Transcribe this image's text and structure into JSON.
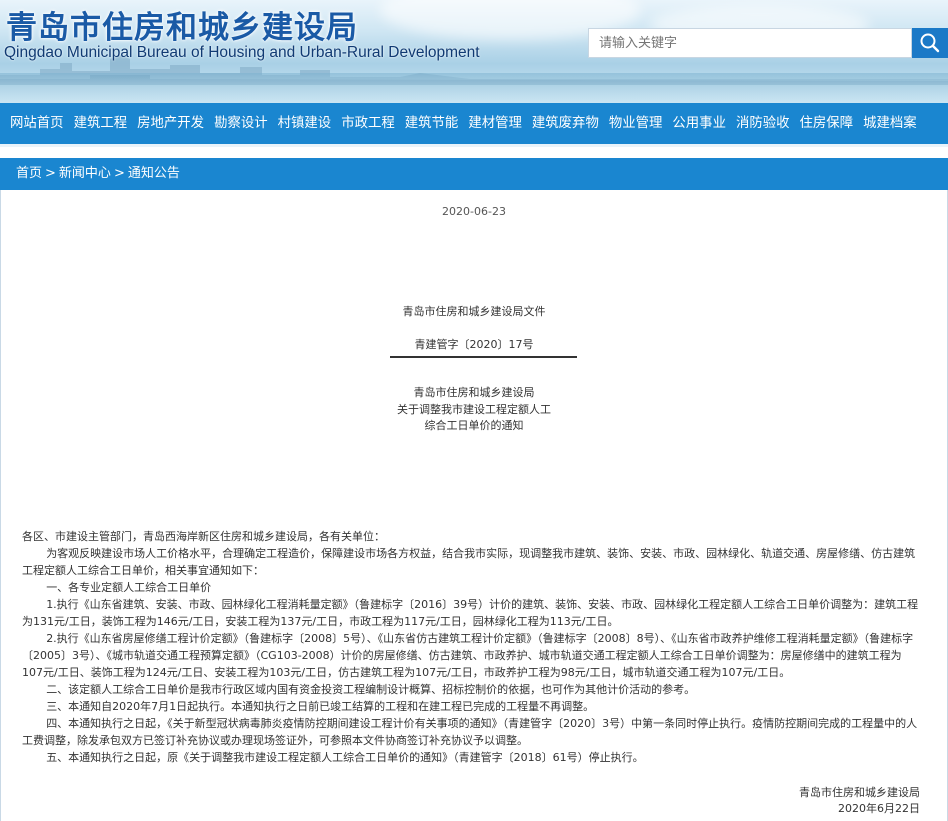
{
  "header": {
    "title_cn": "青岛市住房和城乡建设局",
    "title_en": "Qingdao Municipal Bureau of Housing and Urban-Rural Development",
    "search_placeholder": "请输入关键字"
  },
  "nav": {
    "items": [
      "网站首页",
      "建筑工程",
      "房地产开发",
      "勘察设计",
      "村镇建设",
      "市政工程",
      "建筑节能",
      "建材管理",
      "建筑废弃物",
      "物业管理",
      "公用事业",
      "消防验收",
      "住房保障",
      "城建档案"
    ]
  },
  "breadcrumb": {
    "items": [
      "首页",
      "新闻中心",
      "通知公告"
    ],
    "sep": ">"
  },
  "article": {
    "date": "2020-06-23",
    "doc_header": "青岛市住房和城乡建设局文件",
    "doc_number": "青建管字〔2020〕17号",
    "title_lines": [
      "青岛市住房和城乡建设局",
      "关于调整我市建设工程定额人工",
      "综合工日单价的通知"
    ],
    "salutation": "各区、市建设主管部门，青岛西海岸新区住房和城乡建设局，各有关单位：",
    "paragraphs": [
      "为客观反映建设市场人工价格水平，合理确定工程造价，保障建设市场各方权益，结合我市实际，现调整我市建筑、装饰、安装、市政、园林绿化、轨道交通、房屋修缮、仿古建筑工程定额人工综合工日单价，相关事宜通知如下：",
      "一、各专业定额人工综合工日单价",
      "1.执行《山东省建筑、安装、市政、园林绿化工程消耗量定额》（鲁建标字〔2016〕39号）计价的建筑、装饰、安装、市政、园林绿化工程定额人工综合工日单价调整为：建筑工程为131元/工日，装饰工程为146元/工日，安装工程为137元/工日，市政工程为117元/工日，园林绿化工程为113元/工日。",
      "2.执行《山东省房屋修缮工程计价定额》（鲁建标字〔2008〕5号）、《山东省仿古建筑工程计价定额》（鲁建标字〔2008〕8号）、《山东省市政养护维修工程消耗量定额》（鲁建标字〔2005〕3号）、《城市轨道交通工程预算定额》（CG103-2008）计价的房屋修缮、仿古建筑、市政养护、城市轨道交通工程定额人工综合工日单价调整为：房屋修缮中的建筑工程为107元/工日、装饰工程为124元/工日、安装工程为103元/工日，仿古建筑工程为107元/工日，市政养护工程为98元/工日，城市轨道交通工程为107元/工日。",
      "二、该定额人工综合工日单价是我市行政区域内国有资金投资工程编制设计概算、招标控制价的依据，也可作为其他计价活动的参考。",
      "三、本通知自2020年7月1日起执行。本通知执行之日前已竣工结算的工程和在建工程已完成的工程量不再调整。",
      "四、本通知执行之日起，《关于新型冠状病毒肺炎疫情防控期间建设工程计价有关事项的通知》（青建管字〔2020〕3号）中第一条同时停止执行。疫情防控期间完成的工程量中的人工费调整，除发承包双方已签订补充协议或办理现场签证外，可参照本文件协商签订补充协议予以调整。",
      "五、本通知执行之日起，原《关于调整我市建设工程定额人工综合工日单价的通知》（青建管字〔2018〕61号）停止执行。"
    ],
    "signature": "青岛市住房和城乡建设局",
    "sign_date": "2020年6月22日"
  },
  "colors": {
    "nav_bg": "#1a86d0",
    "title": "#1a5aa6"
  },
  "icons": {
    "search": "search-icon"
  }
}
